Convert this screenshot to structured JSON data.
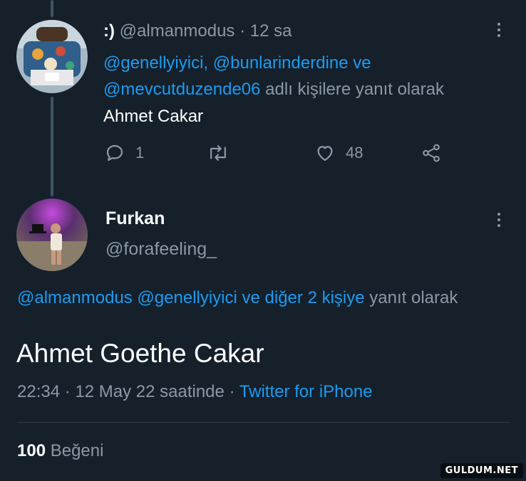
{
  "colors": {
    "background": "#15202b",
    "link": "#1d9bf0",
    "muted": "#8b98a5",
    "text": "#ffffff"
  },
  "reply_tweet": {
    "display_name": ":)",
    "handle": "@almanmodus",
    "separator": "·",
    "time": "12 sa",
    "reply_to": {
      "mention_1": "@genellyiyici,",
      "mention_2": "@bunlarinderdine",
      "connector": "ve",
      "mention_3": "@mevcutduzende06",
      "suffix": "adlı kişilere yanıt olarak"
    },
    "text": "Ahmet Cakar",
    "actions": {
      "reply_count": "1",
      "like_count": "48",
      "reply_icon": "reply-icon",
      "retweet_icon": "retweet-icon",
      "like_icon": "heart-icon",
      "share_icon": "share-icon"
    }
  },
  "main_tweet": {
    "display_name": "Furkan",
    "handle": "@forafeeling_",
    "reply_to": {
      "mentions": "@almanmodus @genellyiyici ve diğer 2 kişiye",
      "suffix": "yanıt olarak"
    },
    "text": "Ahmet Goethe Cakar",
    "time": "22:34",
    "separator": "·",
    "date": "12 May 22 saatinde",
    "separator_2": "·",
    "source": "Twitter for iPhone",
    "likes_count": "100",
    "likes_label": "Beğeni"
  },
  "watermark": "GULDUM.NET"
}
